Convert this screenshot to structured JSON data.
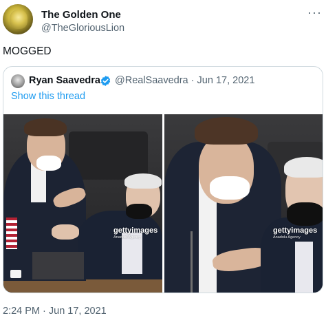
{
  "tweet": {
    "author_name": "The Golden One",
    "author_handle": "@TheGloriousLion",
    "more_icon": "more-horizontal-icon",
    "text": "MOGGED",
    "timestamp": "2:24 PM · Jun 17, 2021"
  },
  "quoted_tweet": {
    "author_name": "Ryan Saavedra",
    "verified_icon": "verified-badge-icon",
    "verified_color": "#1d9bf0",
    "author_handle": "@RealSaavedra",
    "separator": "·",
    "date": "Jun 17, 2021",
    "show_thread": "Show this thread",
    "photos": [
      {
        "watermark": "gettyimages",
        "credit": "Anadolu Agency"
      },
      {
        "watermark": "gettyimages",
        "credit": "Anadolu Agency"
      }
    ]
  },
  "colors": {
    "text_primary": "#0f1419",
    "text_secondary": "#536471",
    "link": "#1d9bf0",
    "border": "#cfd9de"
  }
}
